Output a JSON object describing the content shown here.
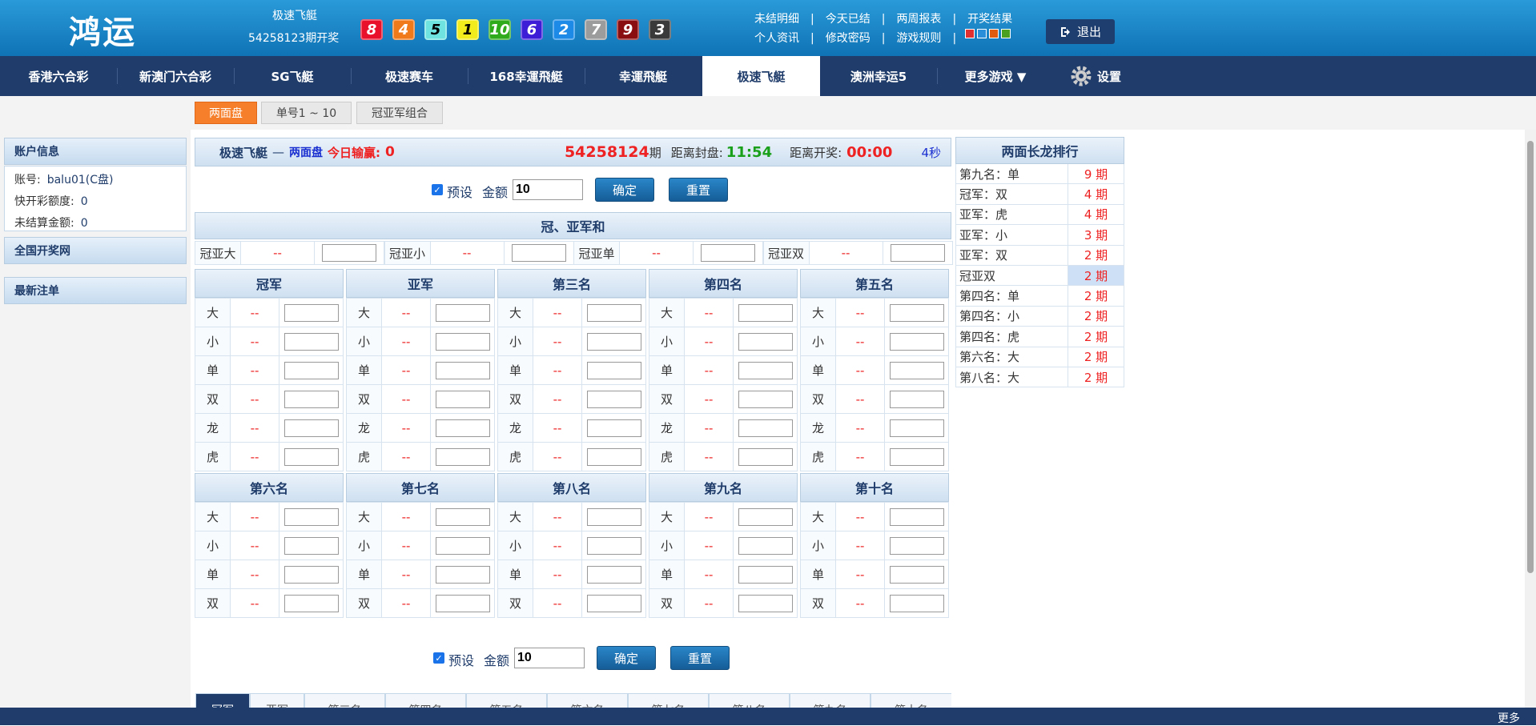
{
  "header": {
    "logo": "鸿运",
    "game_name": "极速飞艇",
    "period_text": "54258123期开奖",
    "balls": [
      {
        "num": "8",
        "color": "#e8102a"
      },
      {
        "num": "4",
        "color": "#f07a1a"
      },
      {
        "num": "5",
        "color": "#6ee3e0"
      },
      {
        "num": "1",
        "color": "#f2ec1c"
      },
      {
        "num": "10",
        "color": "#2eaa1a"
      },
      {
        "num": "6",
        "color": "#3d1ed6"
      },
      {
        "num": "2",
        "color": "#1c8ae6"
      },
      {
        "num": "7",
        "color": "#9c9c9c"
      },
      {
        "num": "9",
        "color": "#8a0d10"
      },
      {
        "num": "3",
        "color": "#3a3a3a"
      }
    ],
    "links_row1": [
      "未结明细",
      "今天已结",
      "两周报表",
      "开奖结果"
    ],
    "links_row2": [
      "个人资讯",
      "修改密码",
      "游戏规则"
    ],
    "skin_colors": [
      "#e03030",
      "#2a8fd8",
      "#e05a10",
      "#4aa020"
    ],
    "logout": "退出"
  },
  "nav": {
    "items": [
      "香港六合彩",
      "新澳门六合彩",
      "SG飞艇",
      "极速赛车",
      "168幸運飛艇",
      "幸運飛艇",
      "极速飞艇",
      "澳洲幸运5",
      "更多游戏 ▼"
    ],
    "active": "极速飞艇",
    "settings": "设置"
  },
  "subtabs": [
    "两面盘",
    "单号1 ~ 10",
    "冠亚军组合"
  ],
  "left": {
    "account_title": "账户信息",
    "account_rows": [
      {
        "label": "账号:",
        "value": "balu01(C盘)"
      },
      {
        "label": "快开彩额度:",
        "value": "0"
      },
      {
        "label": "未结算金额:",
        "value": "0"
      }
    ],
    "national_title": "全国开奖网",
    "latest_title": "最新注单"
  },
  "info": {
    "game": "极速飞艇",
    "dash": "—",
    "mode": "两面盘",
    "win_label": "今日输赢:",
    "win_value": "0",
    "period": "54258124",
    "period_unit": "期",
    "close_label": "距离封盘:",
    "close_time": "11:54",
    "open_label": "距离开奖:",
    "open_time": "00:00",
    "refresh": "4秒"
  },
  "bet_controls": {
    "preset_label": "预设",
    "amount_label": "金额",
    "amount_value": "10",
    "confirm": "确定",
    "reset": "重置"
  },
  "sum_section": {
    "title": "冠、亚军和",
    "items": [
      {
        "label": "冠亚大",
        "odds": "--"
      },
      {
        "label": "冠亚小",
        "odds": "--"
      },
      {
        "label": "冠亚单",
        "odds": "--"
      },
      {
        "label": "冠亚双",
        "odds": "--"
      }
    ]
  },
  "positions_top": {
    "names": [
      "冠军",
      "亚军",
      "第三名",
      "第四名",
      "第五名"
    ],
    "rows": [
      "大",
      "小",
      "单",
      "双",
      "龙",
      "虎"
    ],
    "odds": "--"
  },
  "positions_bottom": {
    "names": [
      "第六名",
      "第七名",
      "第八名",
      "第九名",
      "第十名"
    ],
    "rows": [
      "大",
      "小",
      "单",
      "双"
    ],
    "odds": "--"
  },
  "ranking": {
    "title": "两面长龙排行",
    "rows": [
      {
        "name": "第九名：单",
        "count": "9 期"
      },
      {
        "name": "冠军：双",
        "count": "4 期"
      },
      {
        "name": "亚军：虎",
        "count": "4 期"
      },
      {
        "name": "亚军：小",
        "count": "3 期"
      },
      {
        "name": "亚军：双",
        "count": "2 期"
      },
      {
        "name": "冠亚双",
        "count": "2 期"
      },
      {
        "name": "第四名：单",
        "count": "2 期"
      },
      {
        "name": "第四名：小",
        "count": "2 期"
      },
      {
        "name": "第四名：虎",
        "count": "2 期"
      },
      {
        "name": "第六名：大",
        "count": "2 期"
      },
      {
        "name": "第八名：大",
        "count": "2 期"
      }
    ]
  },
  "bottom_tabs": [
    "冠军",
    "亚军",
    "第三名",
    "第四名",
    "第五名",
    "第六名",
    "第七名",
    "第八名",
    "第九名",
    "第十名"
  ],
  "footer": {
    "more": "更多"
  }
}
